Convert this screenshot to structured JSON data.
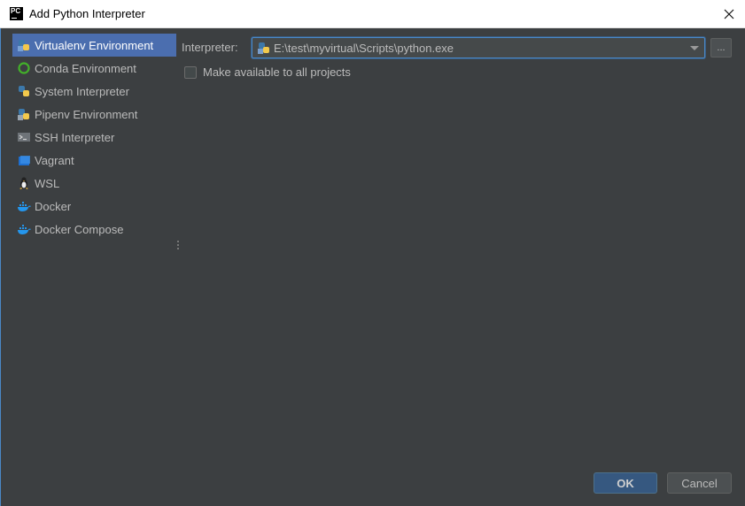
{
  "window": {
    "title": "Add Python Interpreter",
    "logo_text": "PC"
  },
  "sidebar": {
    "items": [
      {
        "label": "Virtualenv Environment",
        "icon": "virtualenv-icon",
        "selected": true
      },
      {
        "label": "Conda Environment",
        "icon": "conda-icon",
        "selected": false
      },
      {
        "label": "System Interpreter",
        "icon": "python-icon",
        "selected": false
      },
      {
        "label": "Pipenv Environment",
        "icon": "pipenv-icon",
        "selected": false
      },
      {
        "label": "SSH Interpreter",
        "icon": "terminal-icon",
        "selected": false
      },
      {
        "label": "Vagrant",
        "icon": "vagrant-icon",
        "selected": false
      },
      {
        "label": "WSL",
        "icon": "linux-tux-icon",
        "selected": false
      },
      {
        "label": "Docker",
        "icon": "docker-icon",
        "selected": false
      },
      {
        "label": "Docker Compose",
        "icon": "docker-compose-icon",
        "selected": false
      }
    ]
  },
  "main": {
    "interpreter_label": "Interpreter:",
    "interpreter_value": "E:\\test\\myvirtual\\Scripts\\python.exe",
    "browse_label": "...",
    "make_available_label": "Make available to all projects",
    "make_available_checked": false
  },
  "buttons": {
    "ok": "OK",
    "cancel": "Cancel"
  },
  "colors": {
    "background": "#3c3f41",
    "selection": "#4b6eaf",
    "focus_border": "#4a88c7",
    "default_button": "#365880"
  }
}
